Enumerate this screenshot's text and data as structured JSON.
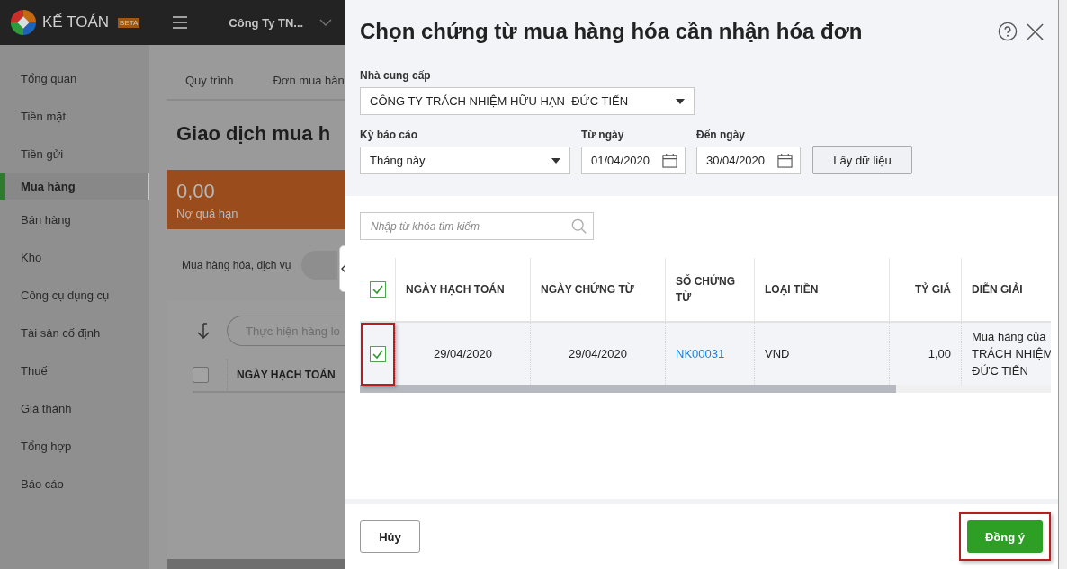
{
  "app": {
    "logo_text": "KẾ TOÁN",
    "badge": "BETA",
    "company": "Công Ty TN...",
    "sidebar": {
      "items": [
        {
          "label": "Tổng quan",
          "selected": false
        },
        {
          "label": "Tiền mặt",
          "selected": false
        },
        {
          "label": "Tiền gửi",
          "selected": false
        },
        {
          "label": "Mua hàng",
          "selected": true
        },
        {
          "label": "Bán hàng",
          "selected": false
        },
        {
          "label": "Kho",
          "selected": false
        },
        {
          "label": "Công cụ dụng cụ",
          "selected": false
        },
        {
          "label": "Tài sản cố định",
          "selected": false
        },
        {
          "label": "Thuế",
          "selected": false
        },
        {
          "label": "Giá thành",
          "selected": false
        },
        {
          "label": "Tổng hợp",
          "selected": false
        },
        {
          "label": "Báo cáo",
          "selected": false
        }
      ]
    },
    "tabs": [
      {
        "label": "Quy trình"
      },
      {
        "label": "Đơn mua hàn"
      }
    ],
    "page_title": "Giao dịch mua h",
    "summary_card": {
      "amount": "0,00",
      "label": "Nợ quá hạn"
    },
    "filter_label": "Mua hàng hóa, dịch vụ",
    "bulk_action_placeholder": "Thực hiện hàng lo",
    "table": {
      "columns": [
        "NGÀY HẠCH TOÁN"
      ],
      "select_all_checked": false
    }
  },
  "dialog": {
    "title": "Chọn chứng từ mua hàng hóa cần nhận hóa đơn",
    "supplier": {
      "label": "Nhà cung cấp",
      "value": "CÔNG TY TRÁCH NHIỆM HỮU HẠN  ĐỨC TIẾN"
    },
    "period": {
      "label": "Kỳ báo cáo",
      "value": "Tháng này"
    },
    "from_date": {
      "label": "Từ ngày",
      "value": "01/04/2020"
    },
    "to_date": {
      "label": "Đến ngày",
      "value": "30/04/2020"
    },
    "fetch_button": "Lấy dữ liệu",
    "search": {
      "placeholder": "Nhập từ khóa tìm kiếm"
    },
    "table": {
      "select_all_checked": true,
      "columns": [
        "NGÀY HẠCH TOÁN",
        "NGÀY CHỨNG TỪ",
        "SỐ CHỨNG TỪ",
        "LOẠI TIỀN",
        "TỶ GIÁ",
        "DIỄN GIẢI"
      ],
      "rows": [
        {
          "checked": true,
          "highlighted": true,
          "posting_date": "29/04/2020",
          "document_date": "29/04/2020",
          "document_no": "NK00031",
          "currency": "VND",
          "exchange_rate": "1,00",
          "description_lines": [
            "Mua hàng của",
            "TRÁCH NHIỆM",
            "ĐỨC TIẾN"
          ]
        }
      ]
    },
    "buttons": [
      {
        "label": "Hủy",
        "kind": "secondary",
        "highlighted": false
      },
      {
        "label": "Đồng ý",
        "kind": "primary",
        "highlighted": true
      }
    ]
  }
}
